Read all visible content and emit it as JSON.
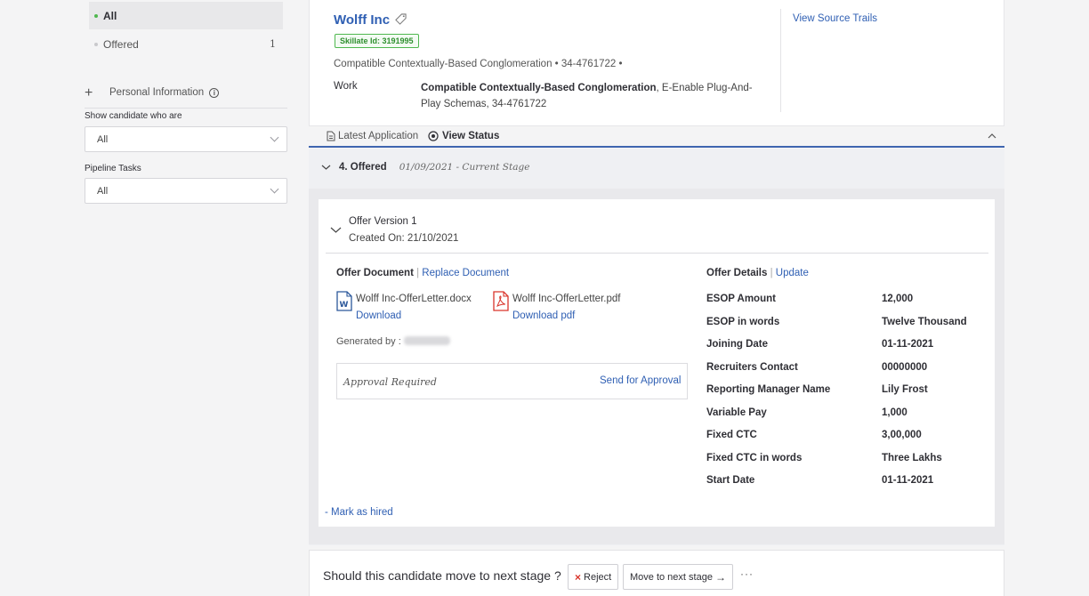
{
  "sidebar": {
    "filters": [
      {
        "label": "All",
        "count": ""
      },
      {
        "label": "Offered",
        "count": "1"
      }
    ],
    "personal_info_label": "Personal Information",
    "show_candidate_label": "Show candidate who are",
    "show_candidate_value": "All",
    "pipeline_tasks_label": "Pipeline Tasks",
    "pipeline_tasks_value": "All"
  },
  "candidate": {
    "name": "Wolff Inc",
    "skillate_id": "Skillate Id: 3191995",
    "summary": "Compatible Contextually-Based Conglomeration • 34-4761722 •",
    "work_label": "Work",
    "work_company": "Compatible Contextually-Based Conglomeration",
    "work_rest": ", E-Enable Plug-And-Play Schemas, 34-4761722",
    "view_source_trails": "View Source Trails"
  },
  "tabs": {
    "latest_application": "Latest Application",
    "view_status": "View Status"
  },
  "stage": {
    "name": "4. Offered",
    "date": "01/09/2021 - Current Stage"
  },
  "offer": {
    "version": "Offer Version 1",
    "created_on": "Created On: 21/10/2021",
    "doc_title": "Offer Document",
    "replace_document": "Replace Document",
    "docx_name": "Wolff Inc-OfferLetter.docx",
    "docx_download": "Download",
    "pdf_name": "Wolff Inc-OfferLetter.pdf",
    "pdf_download": "Download pdf",
    "generated_by": "Generated by :",
    "approval_required": "Approval Required",
    "send_for_approval": "Send for Approval",
    "details_title": "Offer Details",
    "update": "Update",
    "details": [
      {
        "label": "ESOP Amount",
        "value": "12,000"
      },
      {
        "label": "ESOP in words",
        "value": "Twelve Thousand"
      },
      {
        "label": "Joining Date",
        "value": "01-11-2021"
      },
      {
        "label": "Recruiters Contact",
        "value": "00000000"
      },
      {
        "label": "Reporting Manager Name",
        "value": "Lily Frost"
      },
      {
        "label": "Variable Pay",
        "value": "1,000"
      },
      {
        "label": "Fixed CTC",
        "value": "3,00,000"
      },
      {
        "label": "Fixed CTC in words",
        "value": "Three Lakhs"
      },
      {
        "label": "Start Date",
        "value": "01-11-2021"
      }
    ],
    "mark_as_hired": "- Mark as hired"
  },
  "footer": {
    "question": "Should this candidate move to next stage ?",
    "reject": "Reject",
    "move_next": "Move to next stage",
    "more": "···"
  },
  "colors": {
    "link": "#2f5fb3",
    "badge_green": "#4fb84f",
    "reject_red": "#d9342b",
    "pdf_red": "#d9342b",
    "word_blue": "#2b579a"
  }
}
